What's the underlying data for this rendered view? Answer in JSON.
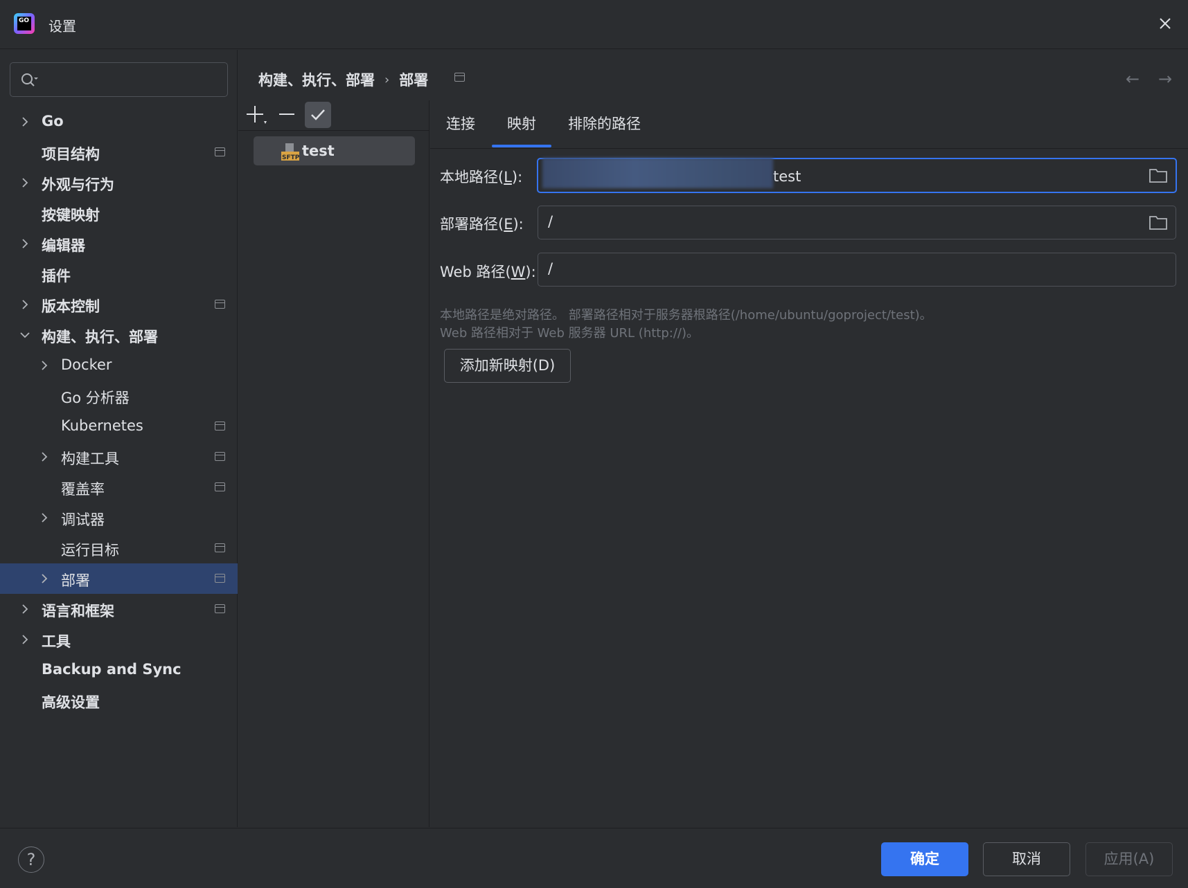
{
  "window": {
    "title": "设置",
    "logo_text": "GO"
  },
  "sidebar": {
    "search_placeholder": "",
    "items": [
      {
        "label": "Go",
        "level": 0,
        "chevron": "right",
        "bold": true,
        "proj_icon": false,
        "selected": false
      },
      {
        "label": "项目结构",
        "level": 0,
        "chevron": "none",
        "bold": true,
        "proj_icon": true,
        "selected": false
      },
      {
        "label": "外观与行为",
        "level": 0,
        "chevron": "right",
        "bold": true,
        "proj_icon": false,
        "selected": false
      },
      {
        "label": "按键映射",
        "level": 0,
        "chevron": "none",
        "bold": true,
        "proj_icon": false,
        "selected": false
      },
      {
        "label": "编辑器",
        "level": 0,
        "chevron": "right",
        "bold": true,
        "proj_icon": false,
        "selected": false
      },
      {
        "label": "插件",
        "level": 0,
        "chevron": "none",
        "bold": true,
        "proj_icon": false,
        "selected": false
      },
      {
        "label": "版本控制",
        "level": 0,
        "chevron": "right",
        "bold": true,
        "proj_icon": true,
        "selected": false
      },
      {
        "label": "构建、执行、部署",
        "level": 0,
        "chevron": "down",
        "bold": true,
        "proj_icon": false,
        "selected": false
      },
      {
        "label": "Docker",
        "level": 1,
        "chevron": "right",
        "bold": false,
        "proj_icon": false,
        "selected": false
      },
      {
        "label": "Go 分析器",
        "level": 1,
        "chevron": "none",
        "bold": false,
        "proj_icon": false,
        "selected": false
      },
      {
        "label": "Kubernetes",
        "level": 1,
        "chevron": "none",
        "bold": false,
        "proj_icon": true,
        "selected": false
      },
      {
        "label": "构建工具",
        "level": 1,
        "chevron": "right",
        "bold": false,
        "proj_icon": true,
        "selected": false
      },
      {
        "label": "覆盖率",
        "level": 1,
        "chevron": "none",
        "bold": false,
        "proj_icon": true,
        "selected": false
      },
      {
        "label": "调试器",
        "level": 1,
        "chevron": "right",
        "bold": false,
        "proj_icon": false,
        "selected": false
      },
      {
        "label": "运行目标",
        "level": 1,
        "chevron": "none",
        "bold": false,
        "proj_icon": true,
        "selected": false
      },
      {
        "label": "部署",
        "level": 1,
        "chevron": "right",
        "bold": false,
        "proj_icon": true,
        "selected": true
      },
      {
        "label": "语言和框架",
        "level": 0,
        "chevron": "right",
        "bold": true,
        "proj_icon": true,
        "selected": false
      },
      {
        "label": "工具",
        "level": 0,
        "chevron": "right",
        "bold": true,
        "proj_icon": false,
        "selected": false
      },
      {
        "label": "Backup and Sync",
        "level": 0,
        "chevron": "none",
        "bold": true,
        "proj_icon": false,
        "selected": false
      },
      {
        "label": "高级设置",
        "level": 0,
        "chevron": "none",
        "bold": true,
        "proj_icon": false,
        "selected": false
      }
    ]
  },
  "breadcrumb": {
    "parent": "构建、执行、部署",
    "separator": "›",
    "current": "部署"
  },
  "nav": {
    "back": "←",
    "forward": "→"
  },
  "servers": {
    "items": [
      {
        "label": "test",
        "type": "SFTP"
      }
    ]
  },
  "tabs": {
    "items": [
      "连接",
      "映射",
      "排除的路径"
    ],
    "active_index": 1
  },
  "mapping": {
    "local_path_label_prefix": "本地路径(",
    "local_path_mnemonic": "L",
    "local_path_label_suffix": "):",
    "local_path_value": "test",
    "deploy_path_label_prefix": "部署路径(",
    "deploy_path_mnemonic": "E",
    "deploy_path_label_suffix": "):",
    "deploy_path_value": "/",
    "web_path_label_prefix": "Web 路径(",
    "web_path_mnemonic": "W",
    "web_path_label_suffix": "):",
    "web_path_value": "/",
    "hint_line1": "本地路径是绝对路径。 部署路径相对于服务器根路径(/home/ubuntu/goproject/test)。",
    "hint_line2": "Web 路径相对于 Web 服务器 URL (http://)。",
    "add_mapping_button": "添加新映射(D)"
  },
  "footer": {
    "help": "?",
    "ok": "确定",
    "cancel": "取消",
    "apply": "应用(A)"
  },
  "colors": {
    "background": "#2b2d30",
    "accent": "#3574f0",
    "selected_row": "#2e436e",
    "text": "#dfe1e5",
    "muted_text": "#6f737a"
  }
}
